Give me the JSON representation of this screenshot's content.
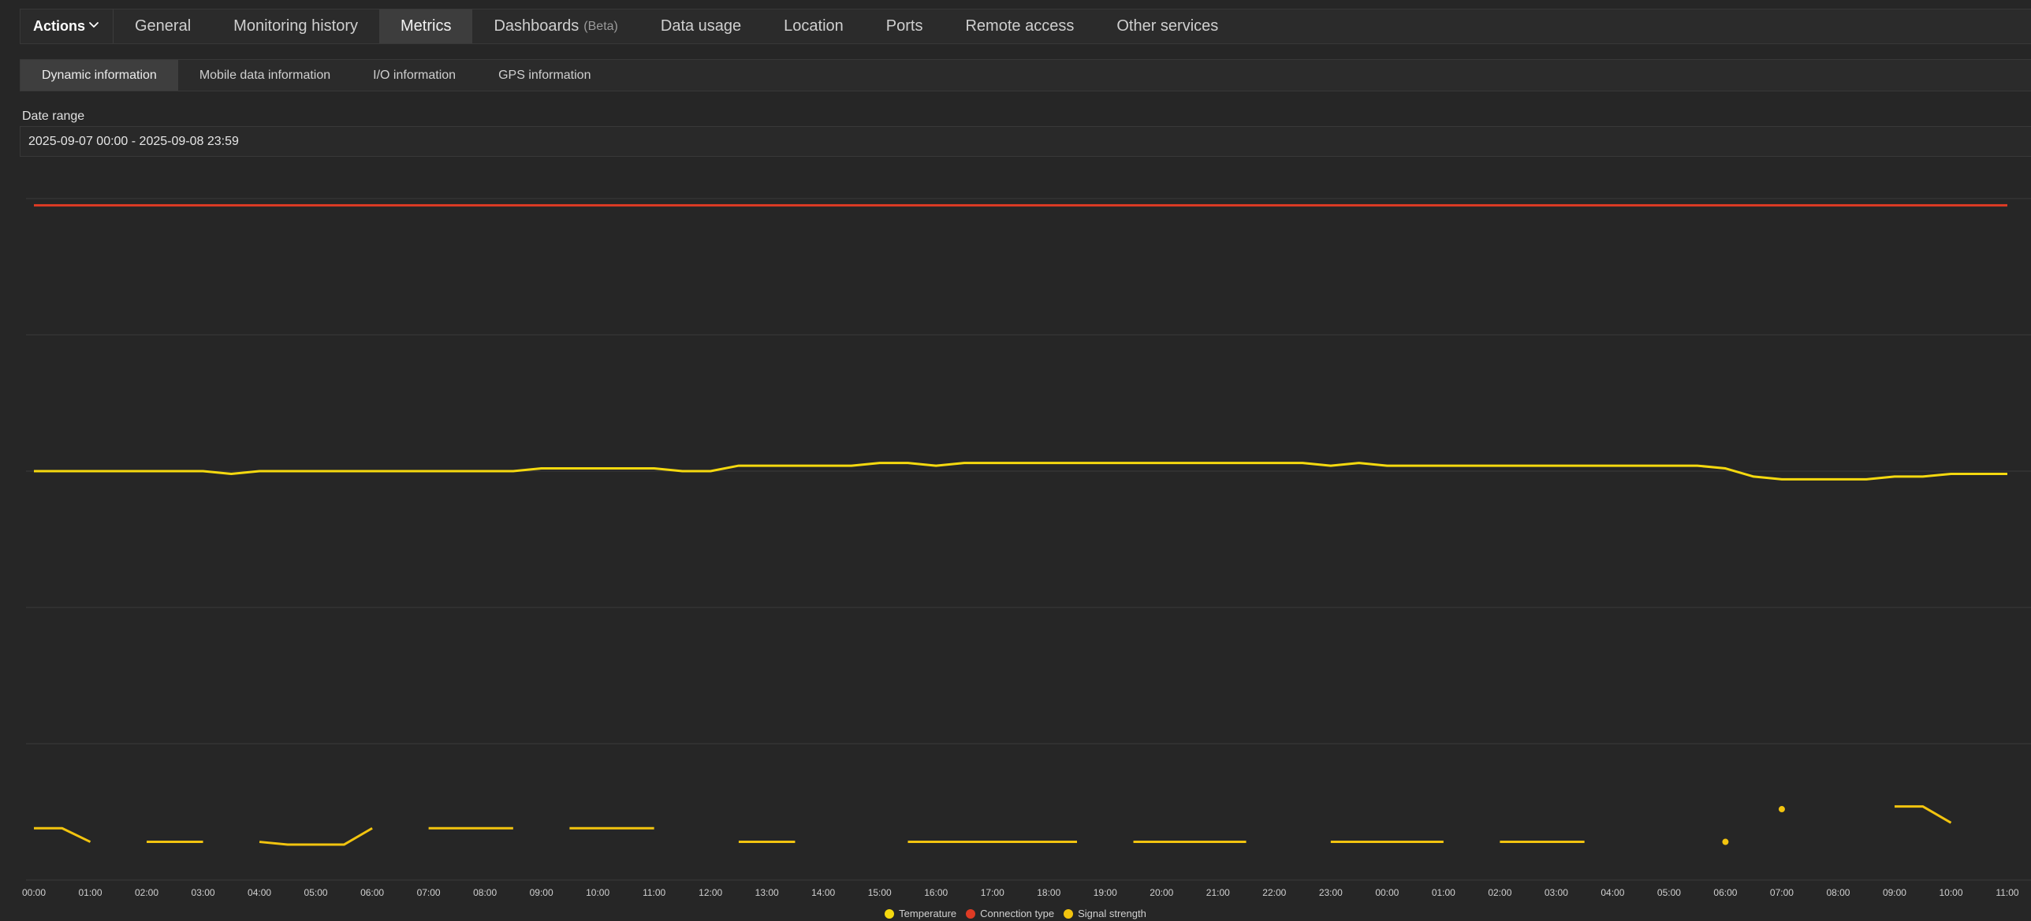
{
  "topnav": {
    "actions_label": "Actions",
    "tabs": [
      {
        "label": "General"
      },
      {
        "label": "Monitoring history"
      },
      {
        "label": "Metrics",
        "active": true
      },
      {
        "label": "Dashboards",
        "suffix": "(Beta)"
      },
      {
        "label": "Data usage"
      },
      {
        "label": "Location"
      },
      {
        "label": "Ports"
      },
      {
        "label": "Remote access"
      },
      {
        "label": "Other services"
      }
    ]
  },
  "subnav": {
    "tabs": [
      {
        "label": "Dynamic information",
        "active": true
      },
      {
        "label": "Mobile data information"
      },
      {
        "label": "I/O information"
      },
      {
        "label": "GPS information"
      }
    ]
  },
  "filter": {
    "label": "Date range",
    "value": "2025-09-07 00:00 - 2025-09-08 23:59"
  },
  "chart_data": {
    "type": "line",
    "x_ticks": [
      "00:00",
      "01:00",
      "02:00",
      "03:00",
      "04:00",
      "05:00",
      "06:00",
      "07:00",
      "08:00",
      "09:00",
      "10:00",
      "11:00",
      "12:00",
      "13:00",
      "14:00",
      "15:00",
      "16:00",
      "17:00",
      "18:00",
      "19:00",
      "20:00",
      "21:00",
      "22:00",
      "23:00",
      "00:00",
      "01:00",
      "02:00",
      "03:00",
      "04:00",
      "05:00",
      "06:00",
      "07:00",
      "08:00",
      "09:00",
      "10:00",
      "11:00"
    ],
    "xlim": [
      0,
      35
    ],
    "ylim": [
      0,
      5
    ],
    "grid": true,
    "legend_position": "bottom",
    "series": [
      {
        "name": "Temperature",
        "color": "#f5d90f",
        "points": [
          [
            0,
            3.0
          ],
          [
            3,
            3.0
          ],
          [
            3.5,
            2.98
          ],
          [
            4,
            3.0
          ],
          [
            8.5,
            3.0
          ],
          [
            9,
            3.02
          ],
          [
            11,
            3.02
          ],
          [
            11.5,
            3.0
          ],
          [
            12,
            3.0
          ],
          [
            12.5,
            3.04
          ],
          [
            14.5,
            3.04
          ],
          [
            15,
            3.06
          ],
          [
            15.5,
            3.06
          ],
          [
            16,
            3.04
          ],
          [
            16.5,
            3.06
          ],
          [
            22.5,
            3.06
          ],
          [
            23,
            3.04
          ],
          [
            23.5,
            3.06
          ],
          [
            24,
            3.04
          ],
          [
            29.5,
            3.04
          ],
          [
            30,
            3.02
          ],
          [
            30.5,
            2.96
          ],
          [
            31,
            2.94
          ],
          [
            32.5,
            2.94
          ],
          [
            33,
            2.96
          ],
          [
            33.5,
            2.96
          ],
          [
            34,
            2.98
          ],
          [
            35,
            2.98
          ]
        ]
      },
      {
        "name": "Connection type",
        "color": "#de3b24",
        "points": [
          [
            0,
            4.95
          ],
          [
            35,
            4.95
          ]
        ]
      },
      {
        "name": "Signal strength",
        "color": "#f2c40f",
        "segments": [
          [
            [
              0,
              0.38
            ],
            [
              0.5,
              0.38
            ],
            [
              1,
              0.28
            ]
          ],
          [
            [
              2,
              0.28
            ],
            [
              3,
              0.28
            ]
          ],
          [
            [
              4,
              0.28
            ],
            [
              4.5,
              0.26
            ],
            [
              5.5,
              0.26
            ],
            [
              6,
              0.38
            ]
          ],
          [
            [
              7,
              0.38
            ],
            [
              8.5,
              0.38
            ]
          ],
          [
            [
              9.5,
              0.38
            ],
            [
              11,
              0.38
            ]
          ],
          [
            [
              12.5,
              0.28
            ],
            [
              13.5,
              0.28
            ]
          ],
          [
            [
              15.5,
              0.28
            ],
            [
              18.5,
              0.28
            ]
          ],
          [
            [
              19.5,
              0.28
            ],
            [
              21.5,
              0.28
            ]
          ],
          [
            [
              23,
              0.28
            ],
            [
              25,
              0.28
            ]
          ],
          [
            [
              26,
              0.28
            ],
            [
              27.5,
              0.28
            ]
          ],
          [
            [
              30,
              0.28
            ]
          ],
          [
            [
              31,
              0.52
            ]
          ],
          [
            [
              33,
              0.54
            ],
            [
              33.5,
              0.54
            ],
            [
              34,
              0.42
            ]
          ]
        ]
      }
    ]
  },
  "legend": [
    {
      "label": "Temperature",
      "color": "#f5d90f"
    },
    {
      "label": "Connection type",
      "color": "#de3b24"
    },
    {
      "label": "Signal strength",
      "color": "#f2c40f"
    }
  ]
}
